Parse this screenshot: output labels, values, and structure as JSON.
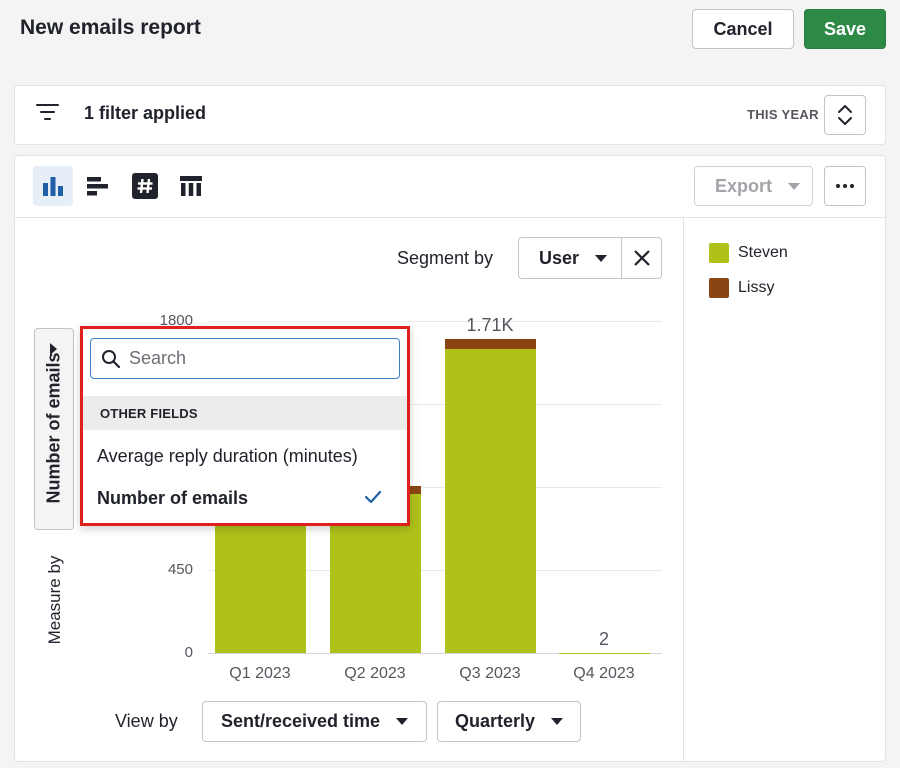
{
  "header": {
    "title": "New emails report",
    "cancel_label": "Cancel",
    "save_label": "Save"
  },
  "filter_bar": {
    "text": "1 filter applied",
    "period_label": "THIS YEAR"
  },
  "toolbar": {
    "export_label": "Export",
    "active_view": "bar-chart"
  },
  "segment": {
    "label": "Segment by",
    "value": "User"
  },
  "legend": [
    {
      "name": "Steven",
      "color": "#aec21a"
    },
    {
      "name": "Lissy",
      "color": "#8b4513"
    }
  ],
  "measure": {
    "tab_label": "Number of emails",
    "label": "Measure by"
  },
  "dropdown": {
    "search_placeholder": "Search",
    "section": "OTHER FIELDS",
    "items": [
      {
        "label": "Average reply duration (minutes)",
        "selected": false
      },
      {
        "label": "Number of emails",
        "selected": true
      }
    ]
  },
  "view_by": {
    "label": "View by",
    "field": "Sent/received time",
    "interval": "Quarterly"
  },
  "chart_data": {
    "type": "bar",
    "stacked": true,
    "categories": [
      "Q1 2023",
      "Q2 2023",
      "Q3 2023",
      "Q4 2023"
    ],
    "series": [
      {
        "name": "Steven",
        "color": "#aec21a",
        "values": [
          840,
          860,
          1650,
          2
        ]
      },
      {
        "name": "Lissy",
        "color": "#8b4513",
        "values": [
          0,
          45,
          55,
          0
        ]
      }
    ],
    "totals": [
      "",
      "",
      "1.71K",
      "2"
    ],
    "ylim": [
      0,
      1800
    ],
    "yticks": [
      "0",
      "450",
      "1800"
    ],
    "grid": true
  }
}
